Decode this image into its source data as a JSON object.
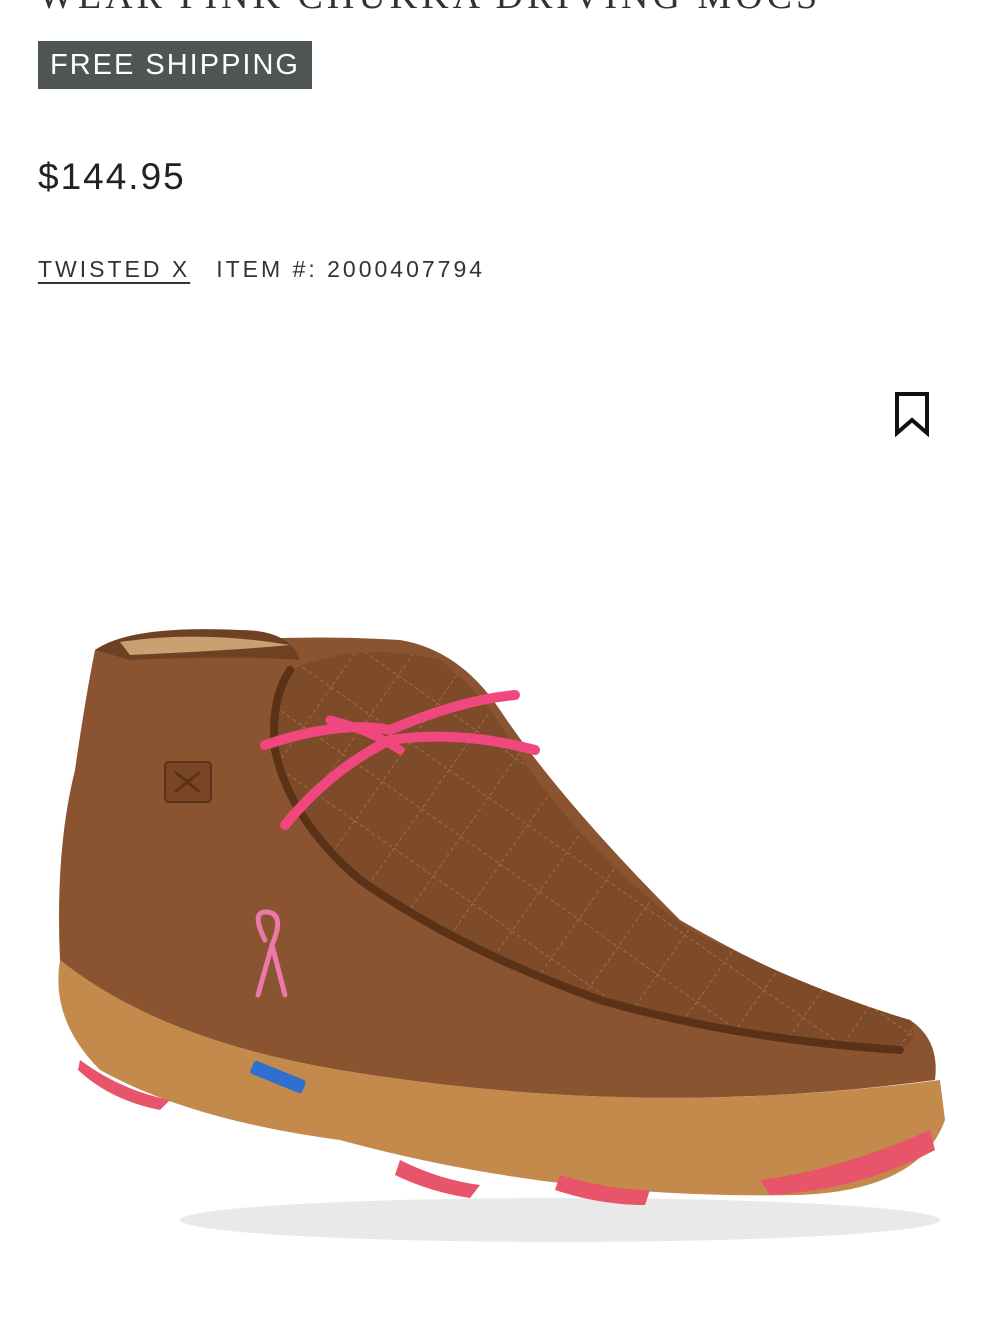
{
  "product": {
    "title_partial": "WEAR PINK CHUKKA DRIVING MOCS",
    "badge": "FREE SHIPPING",
    "price": "$144.95",
    "brand": "TWISTED X",
    "item_label": "ITEM #:",
    "item_number": "2000407794"
  },
  "icons": {
    "bookmark": "bookmark-icon"
  },
  "colors": {
    "badge_bg": "#4f5550",
    "leather": "#8a5430",
    "laces": "#f0487e",
    "sole": "#c48a4c",
    "sole_accent": "#e8546a"
  }
}
